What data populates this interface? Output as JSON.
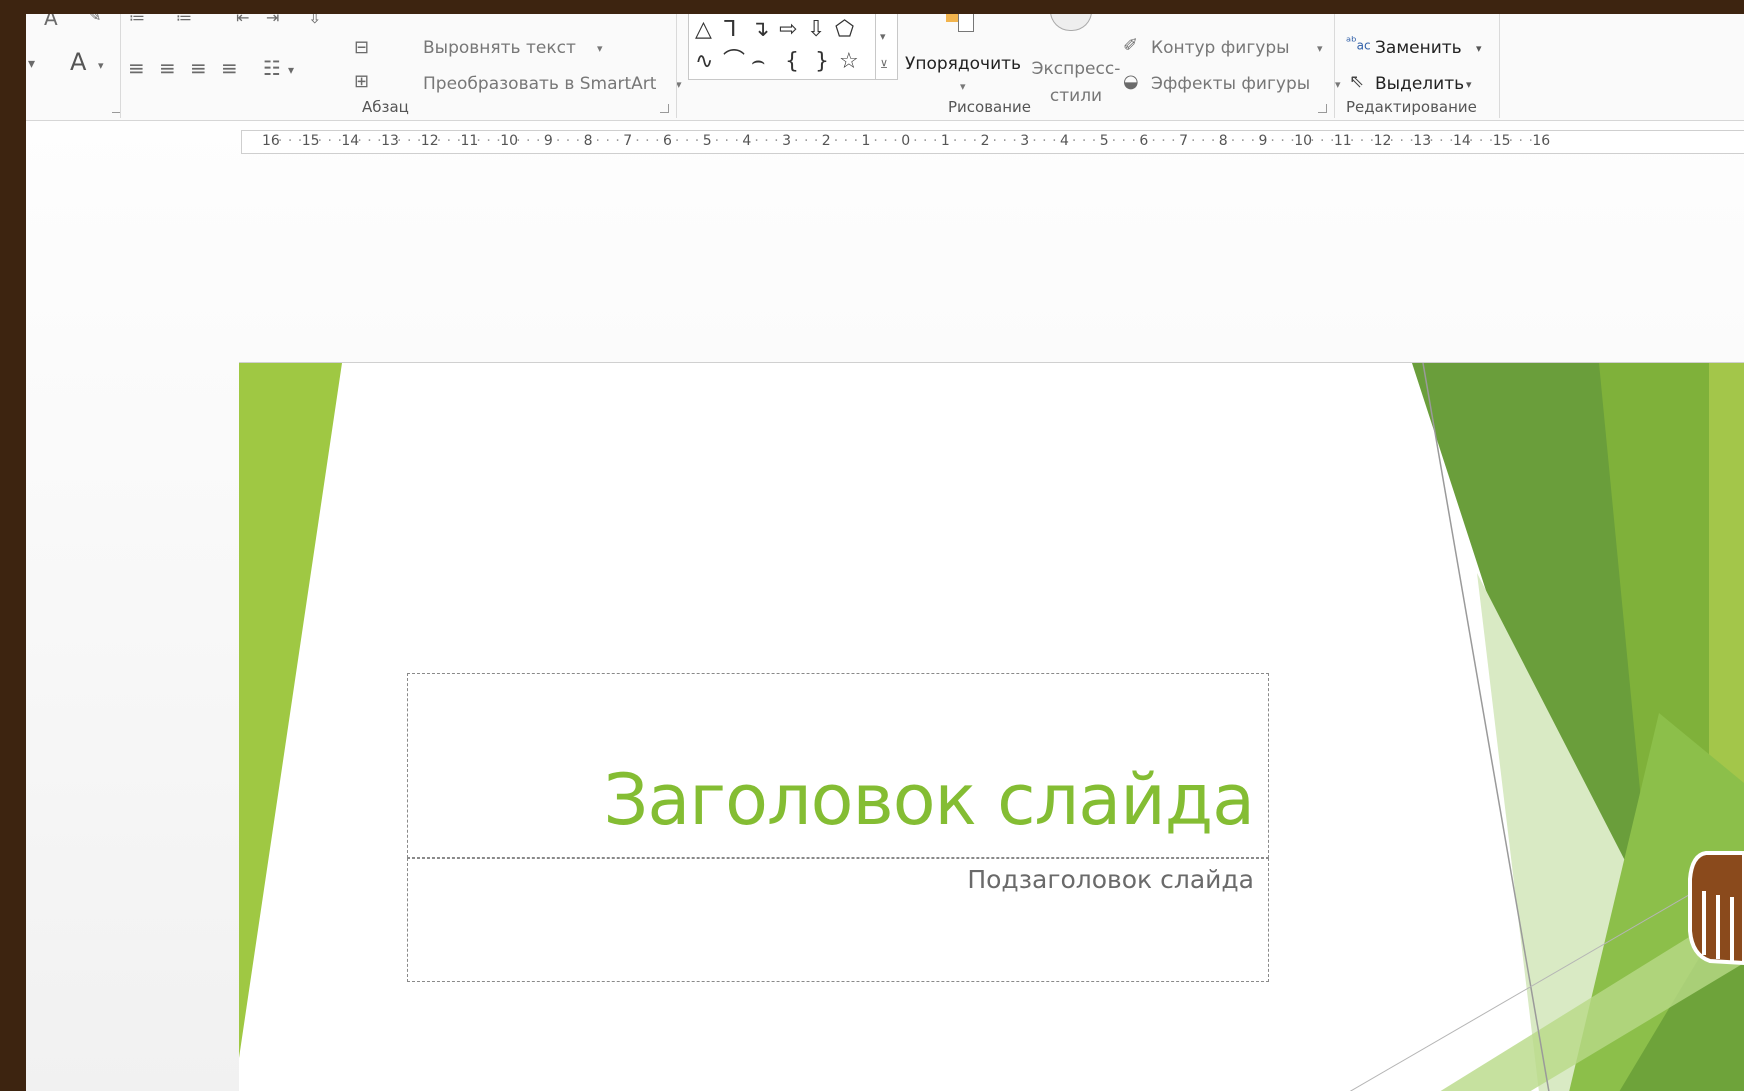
{
  "ribbon": {
    "paragraph": {
      "align_text": "Выровнять текст",
      "convert_smartart": "Преобразовать в SmartArt",
      "group_label": "Абзац"
    },
    "drawing": {
      "arrange": "Упорядочить",
      "quick_styles": "Экспресс-стили",
      "shape_outline": "Контур фигуры",
      "shape_effects": "Эффекты фигуры",
      "group_label": "Рисование"
    },
    "editing": {
      "replace": "Заменить",
      "select": "Выделить",
      "group_label": "Редактирование"
    }
  },
  "ruler": {
    "ticks": [
      "16",
      "15",
      "14",
      "13",
      "12",
      "11",
      "10",
      "9",
      "8",
      "7",
      "6",
      "5",
      "4",
      "3",
      "2",
      "1",
      "0",
      "1",
      "2",
      "3",
      "4",
      "5",
      "6",
      "7",
      "8",
      "9",
      "10",
      "11",
      "12",
      "13",
      "14",
      "15",
      "16"
    ]
  },
  "slide": {
    "title": "Заголовок слайда",
    "subtitle": "Подзаголовок слайда",
    "accent_color": "#84bd33"
  },
  "icons": [
    "font-color-icon",
    "align-left-icon",
    "center-icon",
    "align-right-icon",
    "justify-icon",
    "columns-icon",
    "align-text-icon",
    "smartart-icon",
    "shapes-gallery",
    "outline-icon",
    "effects-icon",
    "replace-icon",
    "select-cursor-icon",
    "hand-cursor-icon"
  ]
}
